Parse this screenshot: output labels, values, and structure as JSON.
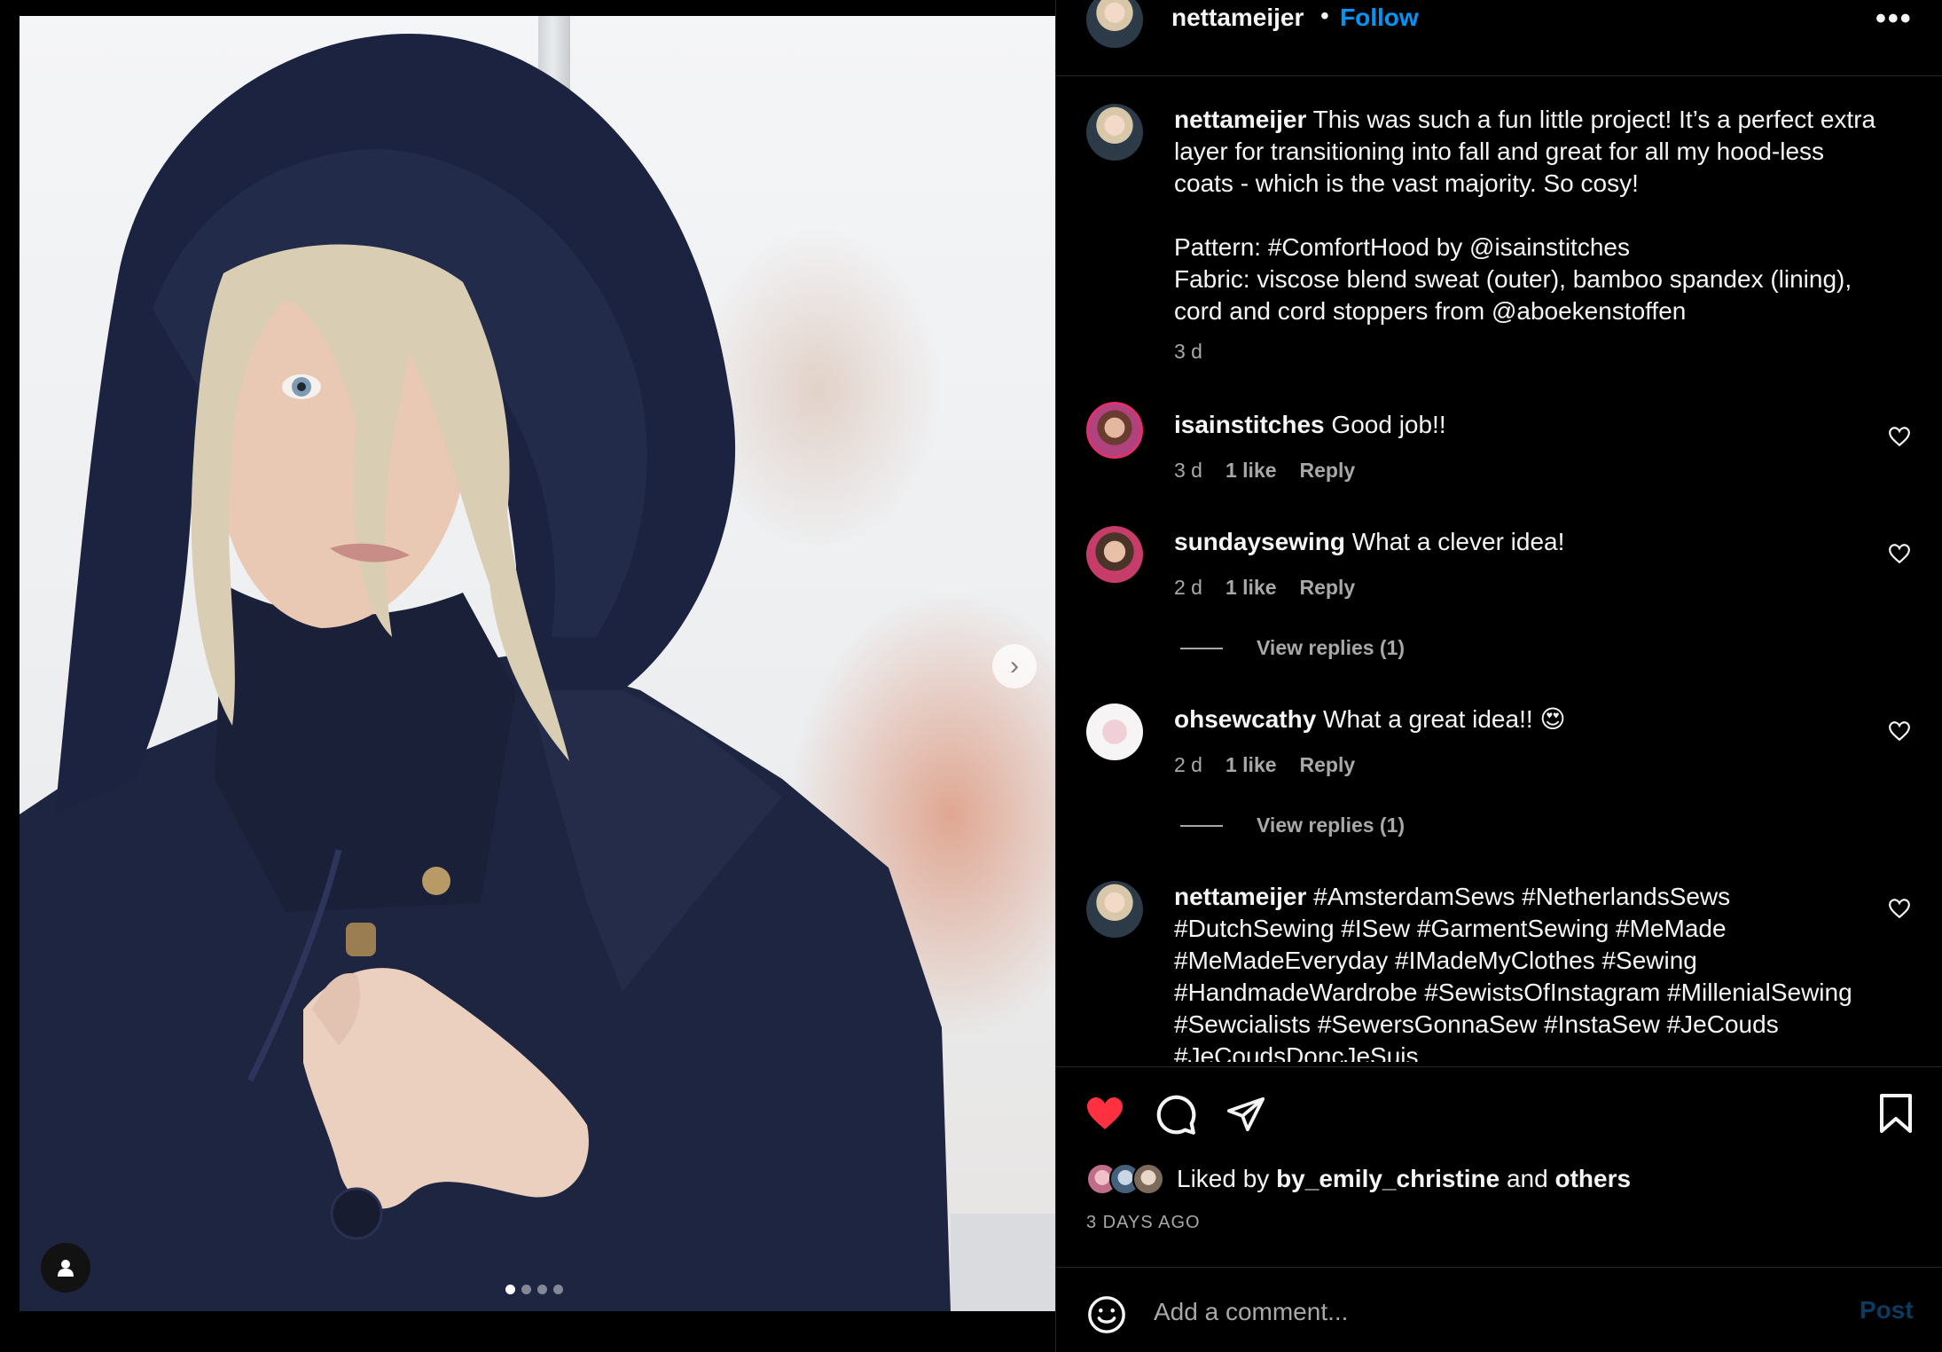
{
  "post": {
    "username": "nettameijer",
    "separator": "•",
    "follow_label": "Follow",
    "more_label": "•••"
  },
  "caption": {
    "username": "nettameijer",
    "text": " This was such a fun little project! It’s a perfect extra layer for transitioning into fall and great for all my hood-less coats - which is the vast majority. So cosy!\n\nPattern: #ComfortHood by @isainstitches\nFabric: viscose blend sweat (outer), bamboo spandex (lining), cord and cord stoppers from @aboekenstoffen",
    "time": "3 d"
  },
  "comments": [
    {
      "username": "isainstitches",
      "text": " Good job!!",
      "time": "3 d",
      "likes": "1 like",
      "reply": "Reply"
    },
    {
      "username": "sundaysewing",
      "text": " What a clever idea!",
      "time": "2 d",
      "likes": "1 like",
      "reply": "Reply",
      "view_replies": "View replies (1)"
    },
    {
      "username": "ohsewcathy",
      "text": " What a great idea!! 😍",
      "time": "2 d",
      "likes": "1 like",
      "reply": "Reply",
      "view_replies": "View replies (1)"
    },
    {
      "username": "nettameijer",
      "text": " #AmsterdamSews #NetherlandsSews #DutchSewing #ISew #GarmentSewing #MeMade #MeMadeEveryday #IMadeMyClothes #Sewing #HandmadeWardrobe #SewistsOfInstagram #MillenialSewing #Sewcialists #SewersGonnaSew #InstaSew #JeCouds #JeCoudsDoncJeSuis"
    }
  ],
  "likes": {
    "prefix": "Liked by ",
    "user": "by_emily_christine",
    "middle": " and ",
    "others": "others"
  },
  "post_time": "3 DAYS AGO",
  "composer": {
    "placeholder": "Add a comment...",
    "post_label": "Post"
  },
  "media": {
    "carousel_count": 4,
    "active_index": 0,
    "next_glyph": "›"
  },
  "colors": {
    "accent": "#0095f6",
    "like_red": "#ff3040",
    "muted": "#a8a8a8",
    "post_disabled": "#0c3a60"
  },
  "icons": [
    "chevron-right-icon",
    "user-tag-icon",
    "heart-filled-icon",
    "comment-icon",
    "share-icon",
    "bookmark-icon",
    "heart-outline-icon",
    "emoji-icon"
  ]
}
